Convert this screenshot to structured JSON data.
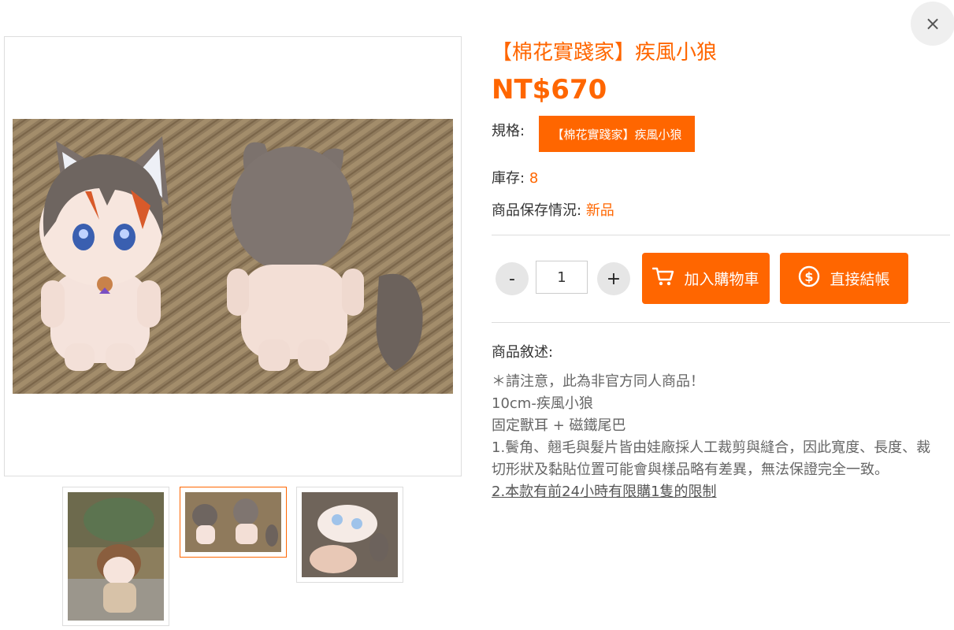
{
  "close_label": "×",
  "product": {
    "title": "【棉花實踐家】疾風小狼",
    "price": "NT$670",
    "spec_label": "規格:",
    "spec_option": "【棉花實踐家】疾風小狼",
    "stock_label": "庫存:",
    "stock_value": "8",
    "condition_label": "商品保存情況:",
    "condition_value": "新品"
  },
  "quantity": {
    "minus": "-",
    "value": "1",
    "plus": "+"
  },
  "actions": {
    "add_to_cart": "加入購物車",
    "buy_now": "直接結帳"
  },
  "description": {
    "label": "商品敘述:",
    "lines": [
      "＊請注意，此為非官方同人商品！",
      "10cm-疾風小狼",
      "固定獸耳 + 磁鐵尾巴",
      "1.鬢角、翹毛與髮片皆由娃廠採人工裁剪與縫合，因此寬度、長度、裁切形狀及黏貼位置可能會與樣品略有差異，無法保證完全一致。",
      "2.本款有前24小時有限購1隻的限制"
    ]
  },
  "colors": {
    "accent": "#ff6600",
    "close_bg": "#efefef",
    "qty_bg": "#e6e6e6"
  },
  "gallery": {
    "active_index": 1,
    "thumbnails": [
      "thumbnail-1",
      "thumbnail-2",
      "thumbnail-3"
    ]
  }
}
